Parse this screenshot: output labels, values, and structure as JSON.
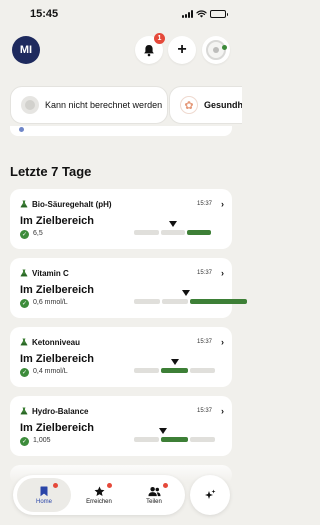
{
  "status_bar": {
    "time": "15:45"
  },
  "header": {
    "avatar_initials": "MI",
    "notification_count": "1",
    "add_label": "+"
  },
  "chips": [
    {
      "label": "Kann nicht berechnet werden"
    },
    {
      "label": "Gesundheit"
    }
  ],
  "section": {
    "title": "Letzte 7 Tage"
  },
  "cards": [
    {
      "name": "Bio-Säuregehalt (pH)",
      "time": "15:37",
      "status": "Im Zielbereich",
      "value": "6,5",
      "range_segment_active": 2,
      "marker_fraction": 0.5
    },
    {
      "name": "Vitamin C",
      "time": "15:37",
      "status": "Im Zielbereich",
      "value": "0,6 mmol/L",
      "range_segment_active": 2,
      "marker_fraction": 0.46
    },
    {
      "name": "Ketonniveau",
      "time": "15:37",
      "status": "Im Zielbereich",
      "value": "0,4 mmol/L",
      "range_segment_active": 1,
      "marker_fraction": 0.5
    },
    {
      "name": "Hydro-Balance",
      "time": "15:37",
      "status": "Im Zielbereich",
      "value": "1,005",
      "range_segment_active": 1,
      "marker_fraction": 0.36
    }
  ],
  "tabs": [
    {
      "label": "Home",
      "icon": "bookmark-icon",
      "active": true
    },
    {
      "label": "Erreichen",
      "icon": "star-icon",
      "active": false
    },
    {
      "label": "Teilen",
      "icon": "people-icon",
      "active": false
    }
  ],
  "colors": {
    "accent_green": "#3d7f36",
    "avatar_navy": "#1e2a5e",
    "badge_red": "#e5493a",
    "active_tab_blue": "#2a45a8",
    "background": "#f1f0ec"
  }
}
